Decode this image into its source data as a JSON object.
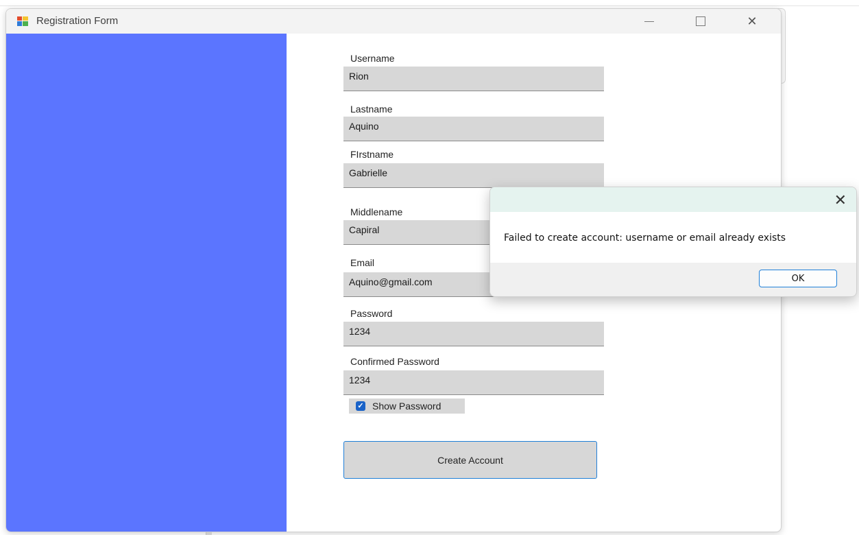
{
  "window": {
    "title": "Registration Form",
    "sidebar_color": "#5b75ff"
  },
  "form": {
    "fields": [
      {
        "label": "Username",
        "value": "Rion"
      },
      {
        "label": "Lastname",
        "value": "Aquino"
      },
      {
        "label": "FIrstname",
        "value": "Gabrielle"
      },
      {
        "label": "Middlename",
        "value": "Capiral"
      },
      {
        "label": "Email",
        "value": "Aquino@gmail.com"
      },
      {
        "label": "Password",
        "value": "1234"
      },
      {
        "label": "Confirmed Password",
        "value": "1234"
      }
    ],
    "show_password_label": "Show Password",
    "show_password_checked": true,
    "create_button_label": "Create Account"
  },
  "dialog": {
    "message": "Failed to create account: username or email already exists",
    "ok_label": "OK"
  },
  "icons": {
    "app": "windows-forms-app-icon",
    "minimize": "minimize-icon",
    "maximize": "maximize-icon",
    "close": "close-icon",
    "checkbox": "checkmark-icon"
  }
}
